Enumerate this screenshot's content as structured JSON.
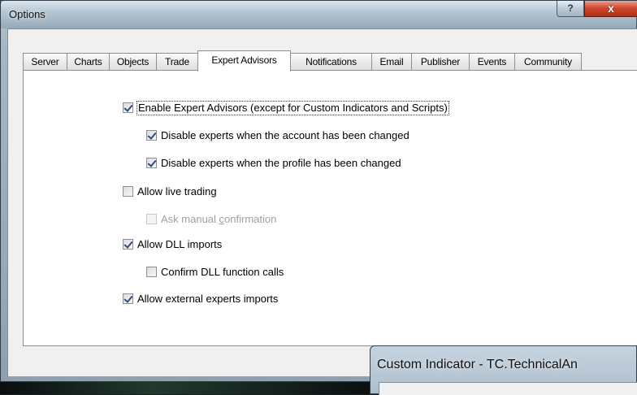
{
  "window": {
    "title": "Options",
    "help_label": "?",
    "close_label": "x"
  },
  "tabs": [
    {
      "label": "Server"
    },
    {
      "label": "Charts"
    },
    {
      "label": "Objects"
    },
    {
      "label": "Trade"
    },
    {
      "label": "Expert Advisors",
      "active": true
    },
    {
      "label": "Notifications"
    },
    {
      "label": "Email"
    },
    {
      "label": "Publisher"
    },
    {
      "label": "Events"
    },
    {
      "label": "Community"
    }
  ],
  "expert_advisors": {
    "enable_experts": {
      "label": "Enable Expert Advisors (except for Custom Indicators and Scripts)",
      "checked": true
    },
    "disable_on_account_change": {
      "label": "Disable experts when the account has been changed",
      "checked": true
    },
    "disable_on_profile_change": {
      "label": "Disable experts when the profile has been changed",
      "checked": true
    },
    "allow_live_trading": {
      "label": "Allow live trading",
      "checked": false
    },
    "ask_manual_confirmation": {
      "label_prefix": "Ask manual ",
      "label_accel": "c",
      "label_suffix": "onfirmation",
      "checked": false,
      "enabled": false
    },
    "allow_dll_imports": {
      "label": "Allow DLL imports",
      "checked": true
    },
    "confirm_dll_calls": {
      "label": "Confirm DLL function calls",
      "checked": false
    },
    "allow_external_imports": {
      "label": "Allow external experts imports",
      "checked": true
    }
  },
  "background_window": {
    "title": "Custom Indicator - TC.TechnicalAn"
  }
}
